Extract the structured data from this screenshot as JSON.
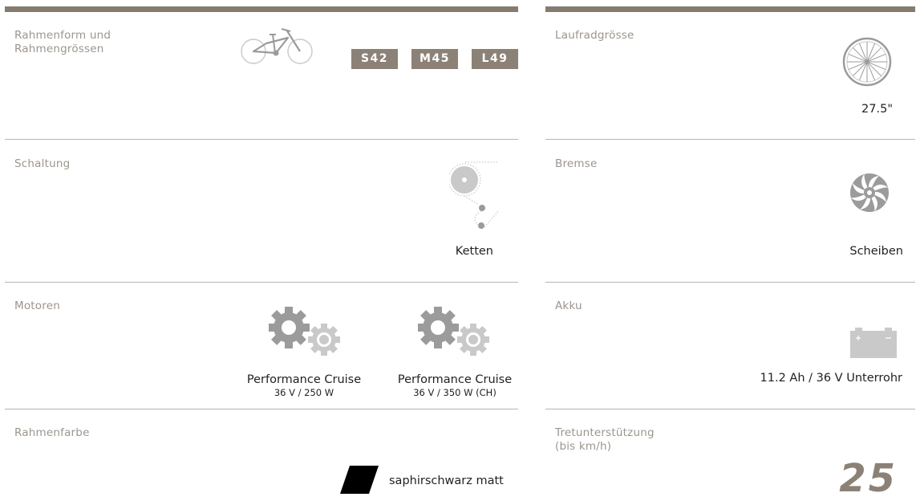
{
  "left": {
    "frame": {
      "label_lines": [
        "Rahmenform und",
        "Rahmengrössen"
      ],
      "sizes": [
        "S42",
        "M45",
        "L49"
      ]
    },
    "gear": {
      "label": "Schaltung",
      "value": "Ketten"
    },
    "motors": {
      "label": "Motoren",
      "items": [
        {
          "name": "Performance Cruise",
          "spec": "36 V / 250 W"
        },
        {
          "name": "Performance Cruise",
          "spec": "36 V / 350 W (CH)"
        }
      ]
    },
    "color": {
      "label": "Rahmenfarbe",
      "value": "saphirschwarz matt",
      "swatch": "#000000"
    }
  },
  "right": {
    "wheel": {
      "label": "Laufradgrösse",
      "value": "27.5\""
    },
    "brake": {
      "label": "Bremse",
      "value": "Scheiben"
    },
    "battery": {
      "label": "Akku",
      "value": "11.2 Ah / 36 V Unterrohr"
    },
    "assist": {
      "label_lines": [
        "Tretunterstützung",
        "(bis km/h)"
      ],
      "value": "25"
    }
  },
  "colors": {
    "accent": "#8c8176",
    "topbar": "#857b71",
    "label": "#9c958e",
    "divider": "#b9b4ae",
    "icon_grey": "#9b9b9b",
    "icon_light": "#c9c9c9"
  },
  "icons": {
    "frame": "bike-frame-icon",
    "gear": "chain-drive-icon",
    "motor": "gears-icon",
    "wheel": "wheel-icon",
    "brake": "brake-disc-icon",
    "battery": "battery-icon"
  }
}
